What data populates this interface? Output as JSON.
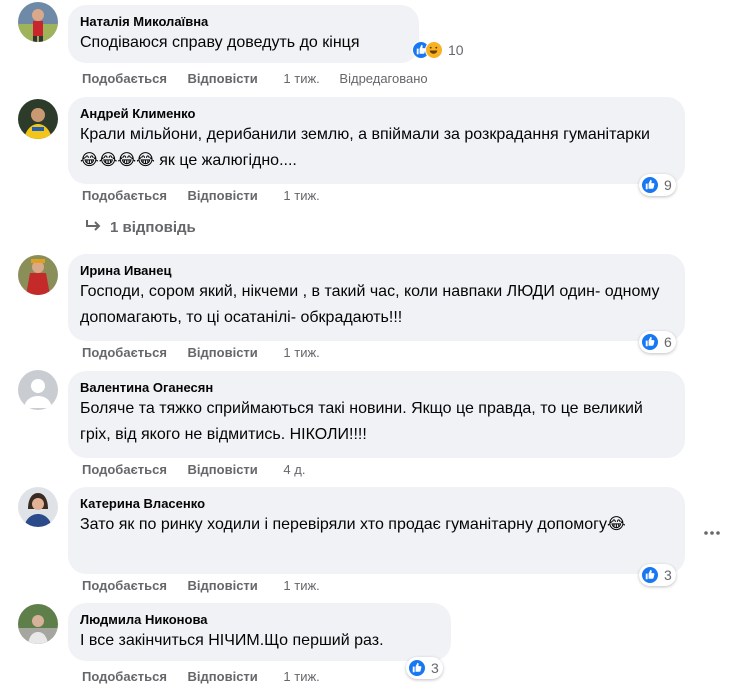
{
  "actions": {
    "like_label": "Подобається",
    "reply_label": "Відповісти"
  },
  "comments": [
    {
      "author": "Наталія Миколаївна",
      "text": "Сподіваюся справу доведуть до кінця",
      "time": "1 тиж.",
      "edited": "Відредаговано",
      "reaction_count": "10",
      "reactions": [
        "like-icon",
        "haha-icon"
      ]
    },
    {
      "author": "Андрей Клименко",
      "text": "Крали мільйони, дерибанили землю, а впіймали за розкрадання гуманітарки😂😂😂😂 як це жалюгідно....",
      "time": "1 тиж.",
      "reaction_count": "9",
      "reactions": [
        "like-icon"
      ]
    },
    {
      "author": "Ирина Иванец",
      "text": "Господи, сором який, нікчеми , в такий час, коли навпаки ЛЮДИ один- одному допомагають, то ці осатанілі- обкрадають!!!",
      "time": "1 тиж.",
      "reaction_count": "6",
      "reactions": [
        "like-icon"
      ]
    },
    {
      "author": "Валентина Оганесян",
      "text": "Боляче та тяжко сприймаються такі новини. Якщо це правда, то це великий гріх, від якого не відмитись. НІКОЛИ!!!!",
      "time": "4 д."
    },
    {
      "author": "Катерина Власенко",
      "text": "Зато як по ринку ходили і перевіряли хто продає гуманітарну допомогу😂",
      "time": "1 тиж.",
      "reaction_count": "3",
      "reactions": [
        "like-icon"
      ]
    },
    {
      "author": "Людмила Никонова",
      "text": "І все закінчиться НІЧИМ.Що перший раз.",
      "time": "1 тиж.",
      "reaction_count": "3",
      "reactions": [
        "like-icon"
      ]
    }
  ],
  "replies": {
    "label": "1 відповідь"
  },
  "colors": {
    "bubble": "#f0f2f5",
    "secondary_text": "#65676b",
    "like_blue": "#1877f2",
    "haha_yellow": "#f7b125"
  }
}
